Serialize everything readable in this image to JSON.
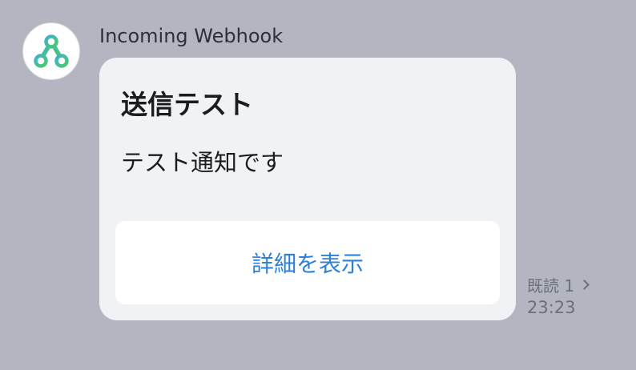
{
  "message": {
    "sender_name": "Incoming Webhook",
    "avatar_icon": "webhook-icon",
    "card": {
      "title": "送信テスト",
      "body": "テスト通知です",
      "button_label": "詳細を表示"
    },
    "read_receipt": "既読 1",
    "timestamp": "23:23"
  },
  "colors": {
    "background": "#b3b6c1",
    "card_background": "#f1f2f6",
    "button_text": "#2e7fd8",
    "meta_text": "#6c6f78",
    "webhook_icon_gradient": [
      "#3db3cf",
      "#4bc96a"
    ]
  }
}
